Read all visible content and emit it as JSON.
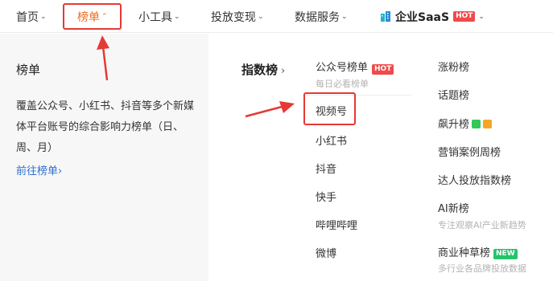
{
  "nav": {
    "items": [
      {
        "label": "首页"
      },
      {
        "label": "榜单"
      },
      {
        "label": "小工具"
      },
      {
        "label": "投放变现"
      },
      {
        "label": "数据服务"
      }
    ],
    "saas": {
      "label": "企业SaaS",
      "badge": "HOT"
    }
  },
  "left": {
    "title": "榜单",
    "description": "覆盖公众号、小红书、抖音等多个新媒体平台账号的综合影响力榜单（日、周、月）",
    "link": "前往榜单",
    "link_arrow": "›"
  },
  "section": {
    "title": "指数榜",
    "arrow": "›"
  },
  "col1": {
    "items": [
      {
        "label": "公众号榜单",
        "badge": "HOT",
        "sub": "每日必看榜单"
      },
      {
        "label": "视频号"
      },
      {
        "label": "小红书"
      },
      {
        "label": "抖音"
      },
      {
        "label": "快手"
      },
      {
        "label": "哔哩哔哩"
      },
      {
        "label": "微博"
      }
    ]
  },
  "col2": {
    "items": [
      {
        "label": "涨粉榜"
      },
      {
        "label": "话题榜"
      },
      {
        "label": "飙升榜"
      },
      {
        "label": "营销案例周榜"
      },
      {
        "label": "达人投放指数榜"
      },
      {
        "label": "AI新榜",
        "sub": "专注观察AI产业新趋势"
      },
      {
        "label": "商业种草榜",
        "badge": "NEW",
        "sub": "多行业各品牌投放数据"
      }
    ]
  },
  "colors": {
    "accent": "#f06a1e",
    "highlight": "#e53935",
    "link": "#2e6fd1",
    "hot": "#f04a4a",
    "new": "#27c26c"
  },
  "icons": [
    "chevron-down-icon",
    "chevron-up-icon",
    "building-logo-icon",
    "wechat-icon",
    "orange-badge-icon",
    "red-arrow-icon"
  ]
}
